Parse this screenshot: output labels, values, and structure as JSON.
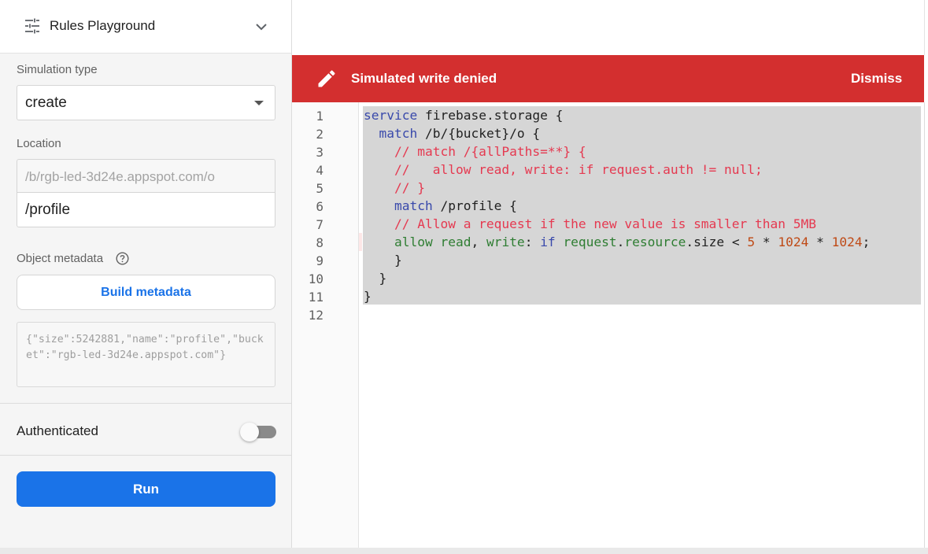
{
  "panel": {
    "title": "Rules Playground",
    "simulation_type_label": "Simulation type",
    "simulation_type_value": "create",
    "location_label": "Location",
    "location_prefix": "/b/rgb-led-3d24e.appspot.com/o",
    "location_value": "/profile",
    "object_metadata_label": "Object metadata",
    "build_metadata_label": "Build metadata",
    "metadata_json": "{\"size\":5242881,\"name\":\"profile\",\"bucket\":\"rgb-led-3d24e.appspot.com\"}",
    "authenticated_label": "Authenticated",
    "authenticated": false,
    "run_label": "Run"
  },
  "banner": {
    "message": "Simulated write denied",
    "dismiss_label": "Dismiss",
    "color": "#d32f2f"
  },
  "editor": {
    "line_numbers": [
      "1",
      "2",
      "3",
      "4",
      "5",
      "6",
      "7",
      "8",
      "9",
      "10",
      "11",
      "12"
    ],
    "lines": [
      "service firebase.storage {",
      "  match /b/{bucket}/o {",
      "    // match /{allPaths=**} {",
      "    //   allow read, write: if request.auth != null;",
      "    // }",
      "    match /profile {",
      "    // Allow a request if the new value is smaller than 5MB",
      "    allow read, write: if request.resource.size < 5 * 1024 * 1024;",
      "    }",
      "  }",
      "}",
      ""
    ]
  },
  "colors": {
    "primary": "#1a73e8",
    "danger": "#d32f2f"
  },
  "icons": {
    "header": "tune-icon",
    "collapse": "chevron-down-icon",
    "help": "help-circle-icon",
    "banner": "pencil-icon"
  }
}
